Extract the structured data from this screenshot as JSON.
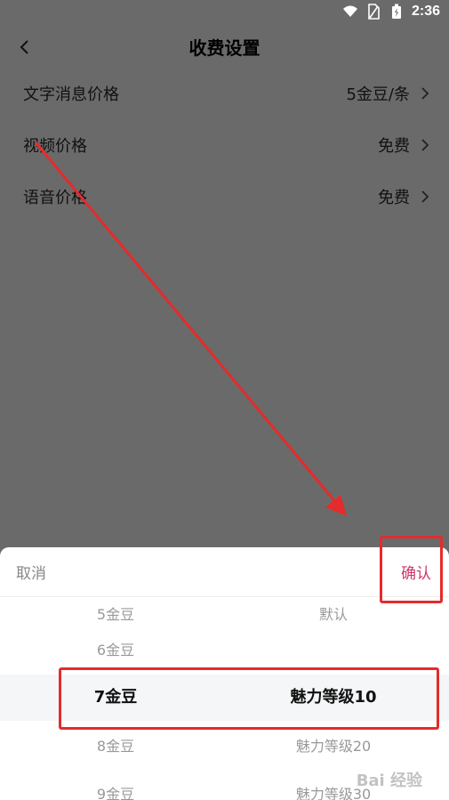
{
  "status_bar": {
    "time": "2:36",
    "icons": [
      "wifi-icon",
      "sim-icon",
      "battery-icon"
    ]
  },
  "header": {
    "title": "收费设置",
    "back_icon": "chevron-left-icon"
  },
  "settings": {
    "items": [
      {
        "label": "文字消息价格",
        "value": "5金豆/条"
      },
      {
        "label": "视频价格",
        "value": "免费"
      },
      {
        "label": "语音价格",
        "value": "免费"
      }
    ]
  },
  "sheet": {
    "cancel_label": "取消",
    "confirm_label": "确认",
    "picker": {
      "rows": [
        {
          "col1": "5金豆",
          "col2": "默认"
        },
        {
          "col1": "6金豆",
          "col2": ""
        },
        {
          "col1": "7金豆",
          "col2": "魅力等级10",
          "selected": true
        },
        {
          "col1": "8金豆",
          "col2": "魅力等级20"
        },
        {
          "col1": "9金豆",
          "col2": "魅力等级30"
        }
      ]
    }
  },
  "watermark": "Bai 经验",
  "colors": {
    "overlay": "#6a6a6a",
    "accent_confirm": "#d0366a",
    "annotation_red": "#e52b2b"
  }
}
